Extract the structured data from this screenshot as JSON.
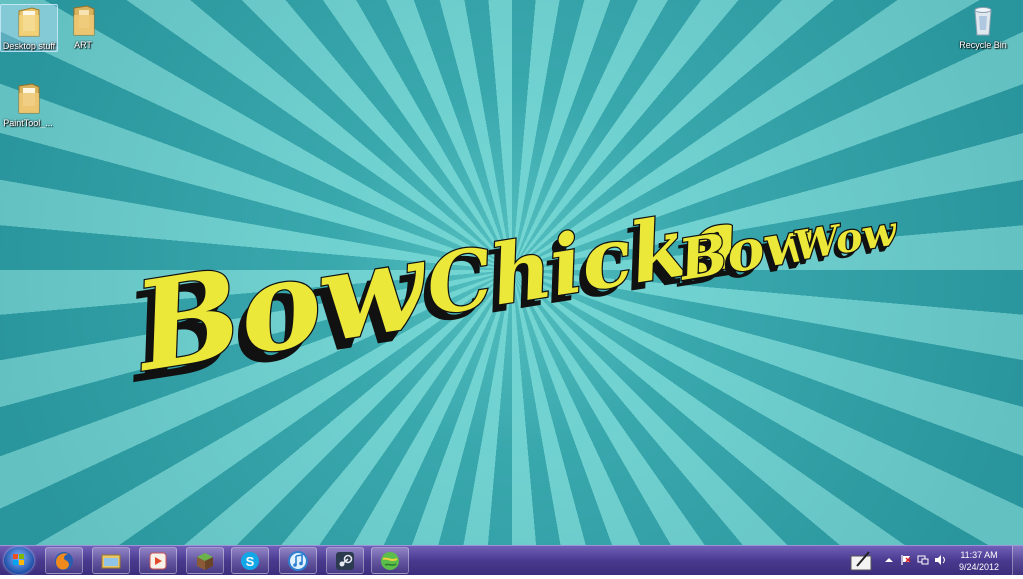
{
  "desktop": {
    "icons": [
      {
        "label": "Desktop stuff"
      },
      {
        "label": "ART"
      },
      {
        "label": "PaintTool_..."
      },
      {
        "label": "Recycle Bin"
      }
    ],
    "wallpaper_text": [
      "Bow",
      "Chicka",
      "Bow",
      "Wow"
    ]
  },
  "taskbar": {
    "apps": [
      {
        "icon": "firefox-icon"
      },
      {
        "icon": "windows-explorer-icon"
      },
      {
        "icon": "media-player-icon"
      },
      {
        "icon": "minecraft-icon"
      },
      {
        "icon": "skype-icon"
      },
      {
        "icon": "itunes-icon"
      },
      {
        "icon": "steam-icon"
      },
      {
        "icon": "globe-app-icon"
      }
    ],
    "clock": {
      "time": "11:37 AM",
      "date": "9/24/2012"
    }
  },
  "colors": {
    "wallpaper_light": "#6fd0cf",
    "wallpaper_dark": "#2e9fa6",
    "wallpaper_text": "#ece83a",
    "taskbar": "#4a3a8f"
  }
}
